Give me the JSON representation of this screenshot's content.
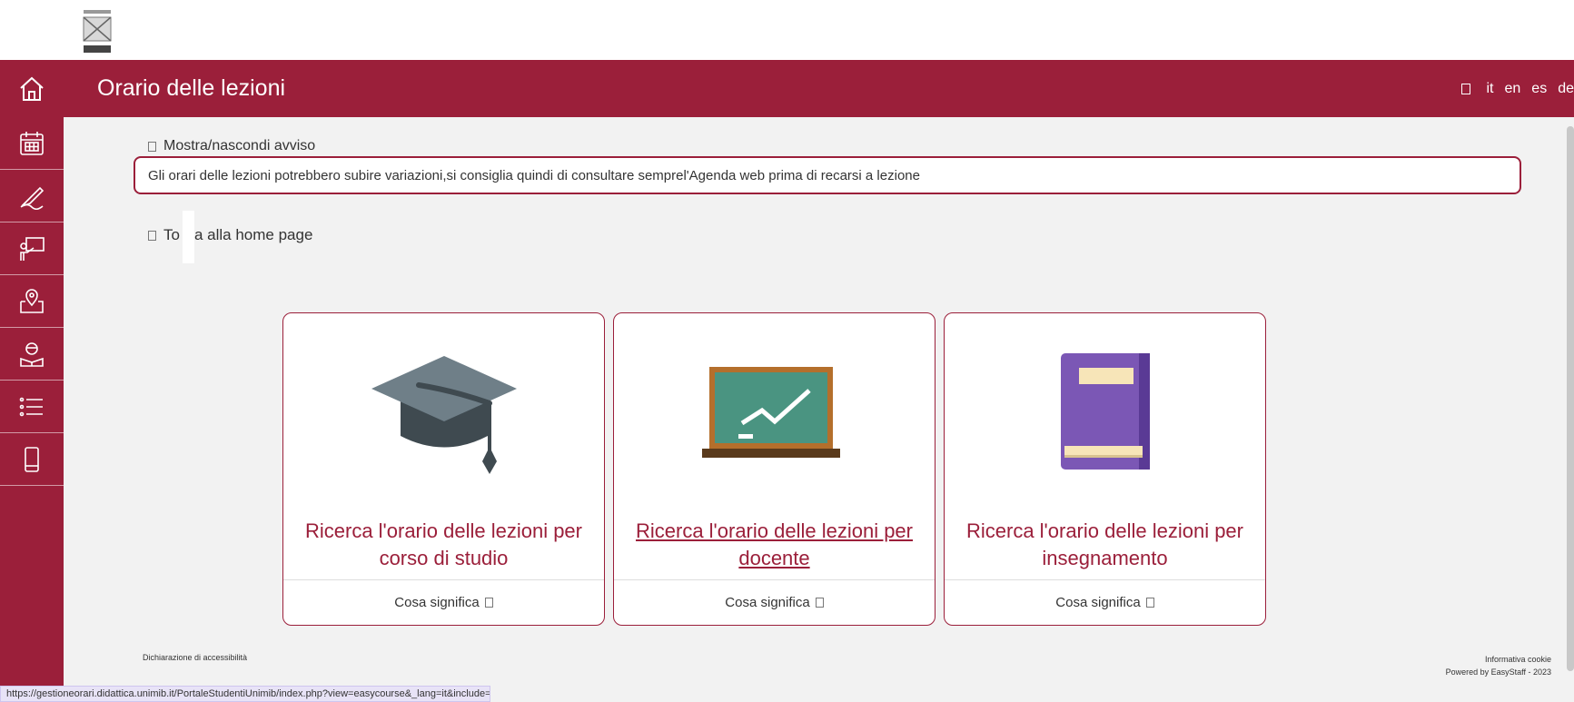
{
  "header": {
    "title": "Orario delle lezioni"
  },
  "languages": [
    "it",
    "en",
    "es",
    "de"
  ],
  "notice": {
    "toggle_label": "Mostra/nascondi avviso",
    "text": "Gli orari delle lezioni potrebbero subire variazioni,si consiglia quindi di consultare semprel'Agenda web prima di recarsi a lezione"
  },
  "back_link": {
    "prefix": "To",
    "suffix": "a alla home page"
  },
  "cards": [
    {
      "title": "Ricerca l'orario delle lezioni per corso di studio",
      "footer": "Cosa significa"
    },
    {
      "title": "Ricerca l'orario delle lezioni per docente",
      "footer": "Cosa significa"
    },
    {
      "title": "Ricerca l'orario delle lezioni per insegnamento",
      "footer": "Cosa significa"
    }
  ],
  "footer": {
    "accessibility": "Dichiarazione di accessibilità",
    "cookie": "Informativa cookie",
    "powered": "Powered by EasyStaff - 2023"
  },
  "status_url": "https://gestioneorari.didattica.unimib.it/PortaleStudentiUnimib/index.php?view=easycourse&_lang=it&include=docente",
  "colors": {
    "brand": "#9b1f3a",
    "cap": "#4a555c",
    "board": "#4a9481",
    "book": "#7b57b5"
  }
}
